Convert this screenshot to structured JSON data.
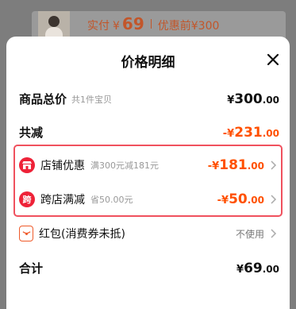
{
  "background_card": {
    "paid_label": "实付",
    "currency": "¥",
    "paid_amount": "69",
    "original_label": "优惠前",
    "original_price": "¥300"
  },
  "sheet": {
    "title": "价格明细",
    "close_icon": "close-icon"
  },
  "rows": {
    "total": {
      "label": "商品总价",
      "sub": "共1件宝贝",
      "cur": "¥",
      "int": "300",
      "dec": ".00"
    },
    "reduce": {
      "label": "共减",
      "cur": "-¥",
      "int": "231",
      "dec": ".00"
    },
    "shop_discount": {
      "label": "店铺优惠",
      "sub": "满300元减181元",
      "cur": "-¥",
      "int": "181",
      "dec": ".00",
      "icon": "shop-icon"
    },
    "cross_discount": {
      "label": "跨店满减",
      "sub": "省50.00元",
      "cur": "-¥",
      "int": "50",
      "dec": ".00",
      "icon_char": "跨"
    },
    "redpacket": {
      "label": "红包(消费券未抵)",
      "status": "不使用",
      "icon": "red-packet-icon"
    },
    "sum": {
      "label": "合计",
      "cur": "¥",
      "int": "69",
      "dec": ".00"
    }
  },
  "colors": {
    "accent_orange": "#ff5000",
    "highlight_border": "#f0515e",
    "icon_red": "#ee2238"
  }
}
